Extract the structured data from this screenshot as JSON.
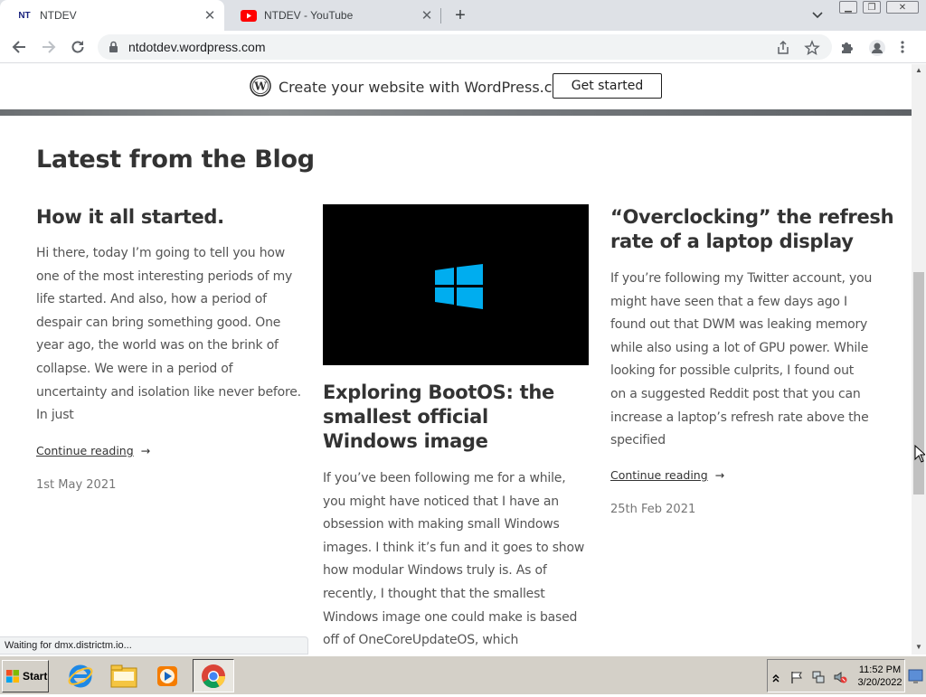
{
  "browser": {
    "tabs": [
      {
        "favicon": "NT",
        "title": "NTDEV",
        "active": true
      },
      {
        "favicon": "youtube-icon",
        "title": "NTDEV - YouTube",
        "active": false
      }
    ],
    "url": "ntdotdev.wordpress.com",
    "status_text": "Waiting for dmx.districtm.io..."
  },
  "wp_banner": {
    "text": "Create your website with WordPress.com",
    "button": "Get started"
  },
  "section_title": "Latest from the Blog",
  "posts": [
    {
      "title": "How it all started.",
      "excerpt": [
        "Hi there, today I’m going to tell you how",
        "one of the most interesting periods of my",
        "life started. And also, how a period of",
        "despair can bring something good. One",
        "year ago, the world was on the brink of",
        "collapse. We were in a period of",
        "uncertainty and isolation like never before.",
        "In just"
      ],
      "link": "Continue reading",
      "arrow": "→",
      "date": "1st May 2021"
    },
    {
      "title": [
        "Exploring BootOS: the",
        "smallest official",
        "Windows image"
      ],
      "excerpt": [
        "If you’ve been following me for a while,",
        "you might have noticed that I have an",
        "obsession with making small Windows",
        "images. I think it’s fun and it goes to show",
        "how modular Windows truly is. As of",
        "recently, I thought that the smallest",
        "Windows image one could make is based",
        "off of OneCoreUpdateOS, which"
      ],
      "has_image": true
    },
    {
      "title": [
        "“Overclocking” the refresh",
        "rate of a laptop display"
      ],
      "excerpt": [
        "If you’re following my Twitter account, you",
        "might have seen that a few days ago I",
        "found out that DWM was leaking memory",
        "while also using a lot of GPU power. While",
        "looking for possible culprits, I found out",
        "on a suggested Reddit post that you can",
        "increase a laptop’s refresh rate above the",
        "specified"
      ],
      "link": "Continue reading",
      "arrow": "→",
      "date": "25th Feb 2021"
    }
  ],
  "taskbar": {
    "start_label": "Start",
    "time": "11:52 PM",
    "date": "3/20/2022"
  },
  "colors": {
    "tab_strip": "#dee1e6",
    "taskbar": "#d4d0c8",
    "windows_logo": "#00adef"
  }
}
